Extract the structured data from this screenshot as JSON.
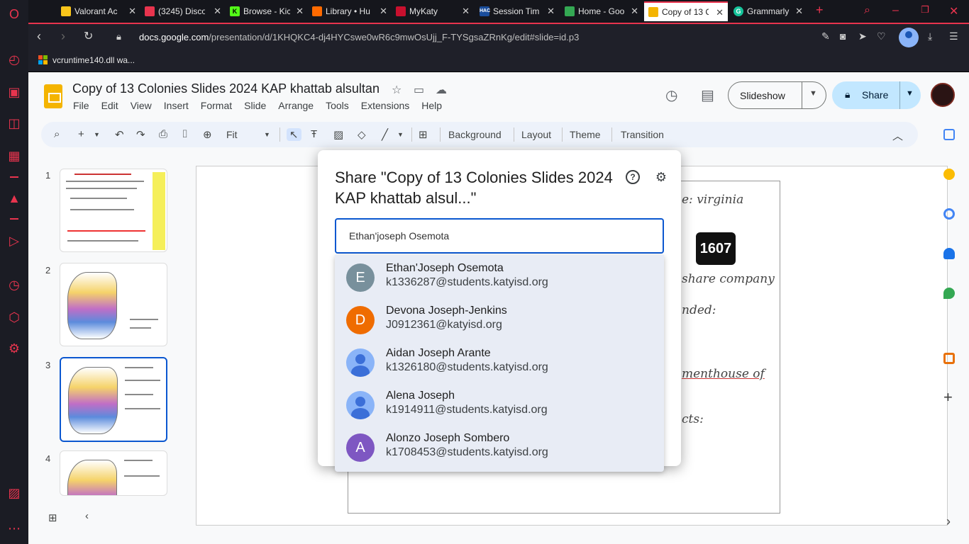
{
  "browser": {
    "tabs": [
      {
        "label": "Valorant Ac",
        "icon": "valorant-icon",
        "color": "#f9c51b"
      },
      {
        "label": "(3245) Disco",
        "icon": "discord-icon",
        "color": "#e8344e"
      },
      {
        "label": "Browse - Kic",
        "icon": "kick-icon",
        "color": "#53fc18"
      },
      {
        "label": "Library • Hu",
        "icon": "library-icon",
        "color": "#ff6a00"
      },
      {
        "label": "MyKaty",
        "icon": "mykaty-icon",
        "color": "#c8102e"
      },
      {
        "label": "Session Tim",
        "icon": "hac-icon",
        "color": "#1a4d9c"
      },
      {
        "label": "Home - Goo",
        "icon": "google-drive-icon",
        "color": "#34a853"
      },
      {
        "label": "Copy of 13 C",
        "icon": "slides-icon",
        "color": "#f4b400"
      },
      {
        "label": "Grammarly",
        "icon": "grammarly-icon",
        "color": "#15c39a"
      }
    ],
    "url_prefix": "docs.google.com",
    "url_rest": "/presentation/d/1KHQKC4-dj4HYCswe0wR6c9mwOsUjj_F-TYSgsaZRnKg/edit#slide=id.p3",
    "bookmark": "vcruntime140.dll wa..."
  },
  "slides": {
    "title": "Copy of 13 Colonies Slides 2024 KAP khattab alsultan",
    "menu": [
      "File",
      "Edit",
      "View",
      "Insert",
      "Format",
      "Slide",
      "Arrange",
      "Tools",
      "Extensions",
      "Help"
    ],
    "slideshow_label": "Slideshow",
    "share_label": "Share",
    "toolbar": {
      "zoom": "Fit",
      "background": "Background",
      "layout": "Layout",
      "theme": "Theme",
      "transition": "Transition"
    },
    "slide_numbers": [
      "1",
      "2",
      "3",
      "4"
    ],
    "canvas_text": {
      "line1": "e: virginia",
      "badge": "1607",
      "line2": "share company",
      "line3": "nded:",
      "line4": "menthouse of",
      "line5": "cts:"
    }
  },
  "dialog": {
    "title": "Share \"Copy of 13 Colonies Slides 2024 KAP khattab alsul...\"",
    "input_value": "Ethan'joseph Osemota",
    "suggestions": [
      {
        "initial": "E",
        "name": "Ethan'Joseph Osemota",
        "email": "k1336287@students.katyisd.org",
        "color": "#78909c"
      },
      {
        "initial": "D",
        "name": "Devona Joseph-Jenkins",
        "email": "J0912361@katyisd.org",
        "color": "#ef6c00"
      },
      {
        "initial": "",
        "name": "Aidan Joseph Arante",
        "email": "k1326180@students.katyisd.org",
        "color": "#8ab4f8"
      },
      {
        "initial": "",
        "name": "Alena Joseph",
        "email": "k1914911@students.katyisd.org",
        "color": "#8ab4f8"
      },
      {
        "initial": "A",
        "name": "Alonzo Joseph Sombero",
        "email": "k1708453@students.katyisd.org",
        "color": "#7e57c2"
      }
    ]
  }
}
